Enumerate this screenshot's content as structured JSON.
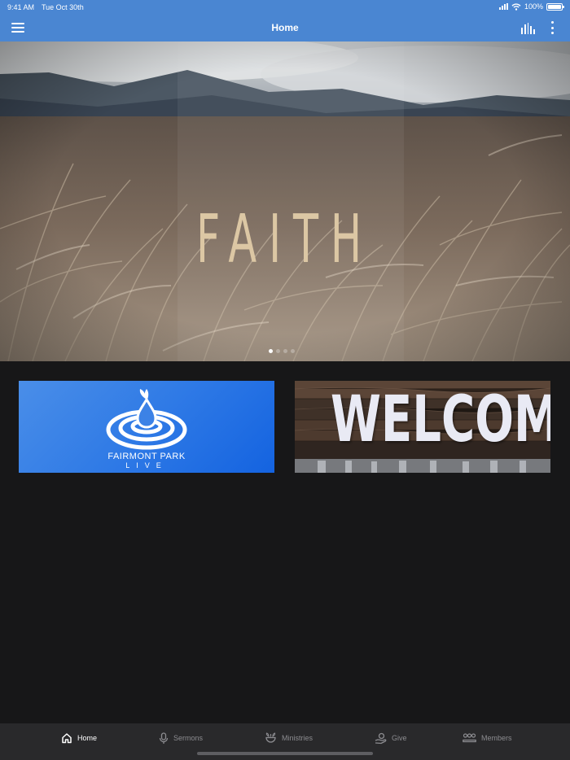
{
  "status": {
    "time": "9:41 AM",
    "date": "Tue Oct 30th",
    "battery": "100%"
  },
  "header": {
    "title": "Home",
    "icons": [
      "menu-icon",
      "audio-bars-icon",
      "more-vertical-icon"
    ],
    "accent": "#4a86d2"
  },
  "banner": {
    "title": "FAITH",
    "slides_total": 4,
    "active_slide": 1
  },
  "cards": [
    {
      "line1": "FAIRMONT PARK",
      "line2": "LIVE"
    },
    {
      "label": "WELCOME"
    }
  ],
  "tabs": [
    {
      "label": "Home",
      "icon": "home-icon",
      "active": true
    },
    {
      "label": "Sermons",
      "icon": "microphone-icon",
      "active": false
    },
    {
      "label": "Ministries",
      "icon": "ministries-icon",
      "active": false
    },
    {
      "label": "Give",
      "icon": "give-icon",
      "active": false
    },
    {
      "label": "Members",
      "icon": "members-icon",
      "active": false
    }
  ]
}
